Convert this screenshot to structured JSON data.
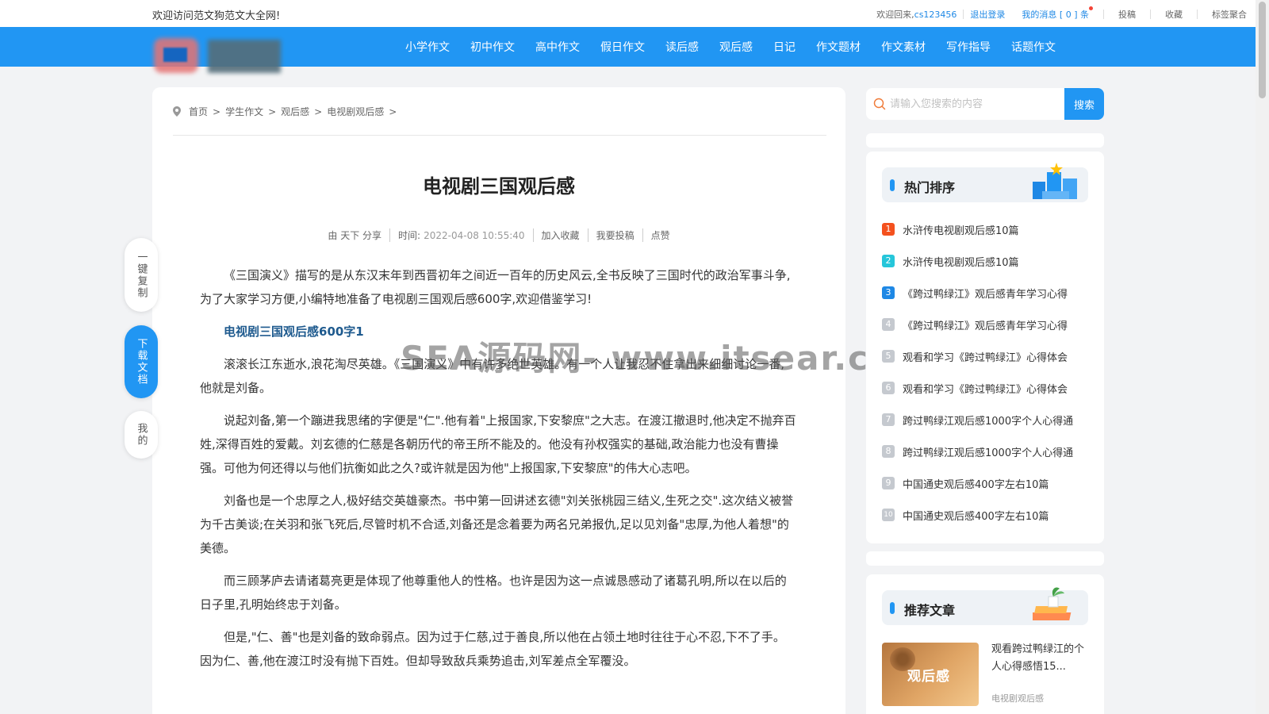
{
  "topbar": {
    "welcome": "欢迎访问范文狗范文大全网!",
    "greeting": "欢迎回来,",
    "username": "cs123456",
    "logout": "退出登录",
    "messages": "我的消息 [ 0 ] 条",
    "links": [
      "投稿",
      "收藏",
      "标签聚合"
    ]
  },
  "nav": {
    "items": [
      "小学作文",
      "初中作文",
      "高中作文",
      "假日作文",
      "读后感",
      "观后感",
      "日记",
      "作文题材",
      "作文素材",
      "写作指导",
      "话题作文"
    ]
  },
  "breadcrumb": {
    "items": [
      "首页",
      "学生作文",
      "观后感",
      "电视剧观后感"
    ],
    "trailing": ">"
  },
  "article": {
    "title": "电视剧三国观后感",
    "author": "由 天下 分享",
    "time_label": "时间:",
    "time": "2022-04-08 10:55:40",
    "actions": [
      "加入收藏",
      "我要投稿",
      "点赞"
    ],
    "intro": "《三国演义》描写的是从东汉末年到西晋初年之间近一百年的历史风云,全书反映了三国时代的政治军事斗争,为了大家学习方便,小编特地准备了电视剧三国观后感600字,欢迎借鉴学习!",
    "subheading": "电视剧三国观后感600字1",
    "paragraphs": [
      "滚滚长江东逝水,浪花淘尽英雄。《三国演义》中有许多绝世英雄。有一个人让我忍不住拿出来细细讨论一番,他就是刘备。",
      "说起刘备,第一个蹦进我思绪的字便是\"仁\".他有着\"上报国家,下安黎庶\"之大志。在渡江撤退时,他决定不抛弃百姓,深得百姓的爱戴。刘玄德的仁慈是各朝历代的帝王所不能及的。他没有孙权强实的基础,政治能力也没有曹操强。可他为何还得以与他们抗衡如此之久?或许就是因为他\"上报国家,下安黎庶\"的伟大心志吧。",
      "刘备也是一个忠厚之人,极好结交英雄豪杰。书中第一回讲述玄德\"刘关张桃园三结义,生死之交\".这次结义被誉为千古美谈;在关羽和张飞死后,尽管时机不合适,刘备还是念着要为两名兄弟报仇,足以见刘备\"忠厚,为他人着想\"的美德。",
      "而三顾茅庐去请诸葛亮更是体现了他尊重他人的性格。也许是因为这一点诚恳感动了诸葛孔明,所以在以后的日子里,孔明始终忠于刘备。",
      "但是,\"仁、善\"也是刘备的致命弱点。因为过于仁慈,过于善良,所以他在占领土地时往往于心不忍,下不了手。因为仁、善,他在渡江时没有抛下百姓。但却导致敌兵乘势追击,刘军差点全军覆没。"
    ]
  },
  "watermark": "SEA源码网- www.itsear.com",
  "float_buttons": {
    "copy": "一键复制",
    "download": "下载文档",
    "mine": "我的"
  },
  "search": {
    "placeholder": "请输入您搜索的内容",
    "button": "搜索"
  },
  "hot": {
    "title": "热门排序",
    "items": [
      {
        "rank": "1",
        "title": "水浒传电视剧观后感10篇",
        "color": "#f4511e"
      },
      {
        "rank": "2",
        "title": "水浒传电视剧观后感10篇",
        "color": "#26c6da"
      },
      {
        "rank": "3",
        "title": "《跨过鸭绿江》观后感青年学习心得",
        "color": "#1e88e5"
      },
      {
        "rank": "4",
        "title": "《跨过鸭绿江》观后感青年学习心得",
        "color": "#c5c9cf"
      },
      {
        "rank": "5",
        "title": "观看和学习《跨过鸭绿江》心得体会",
        "color": "#c5c9cf"
      },
      {
        "rank": "6",
        "title": "观看和学习《跨过鸭绿江》心得体会",
        "color": "#c5c9cf"
      },
      {
        "rank": "7",
        "title": "跨过鸭绿江观后感1000字个人心得通",
        "color": "#c5c9cf"
      },
      {
        "rank": "8",
        "title": "跨过鸭绿江观后感1000字个人心得通",
        "color": "#c5c9cf"
      },
      {
        "rank": "9",
        "title": "中国通史观后感400字左右10篇",
        "color": "#c5c9cf"
      },
      {
        "rank": "10",
        "title": "中国通史观后感400字左右10篇",
        "color": "#c5c9cf"
      }
    ]
  },
  "recommend": {
    "title": "推荐文章",
    "thumb_label": "观后感",
    "article_title": "观看跨过鸭绿江的个人心得感悟15...",
    "article_category": "电视剧观后感"
  },
  "colors": {
    "primary": "#2196f3",
    "background": "#f2f3f5",
    "subheading": "#1e5a8e"
  }
}
